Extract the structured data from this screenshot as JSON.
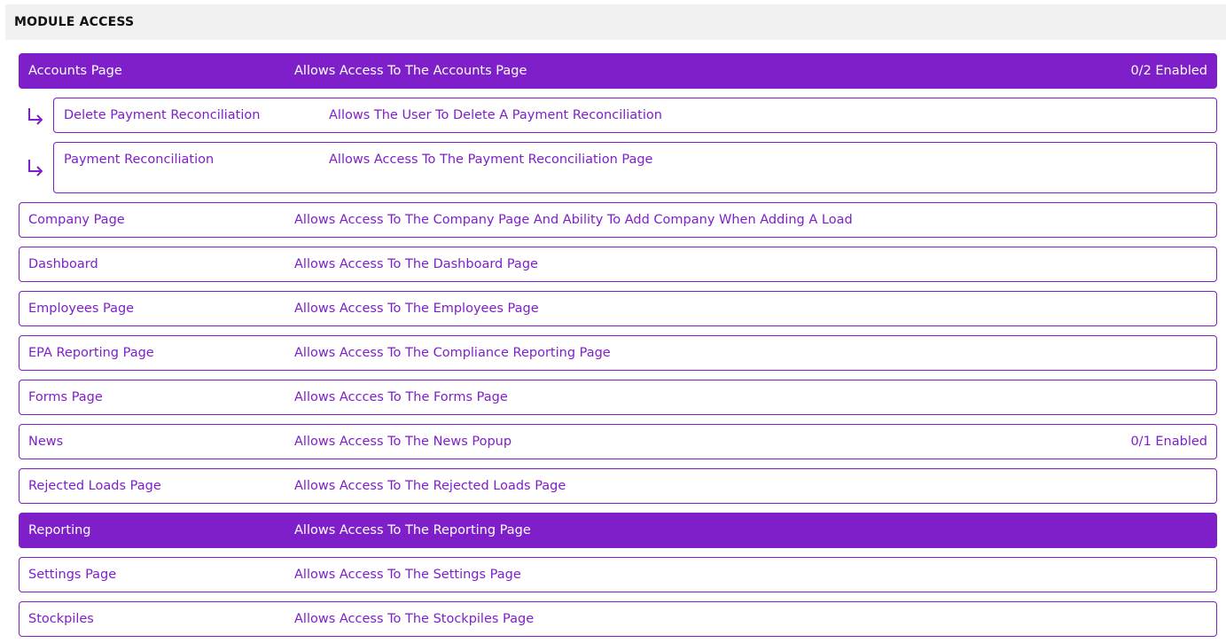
{
  "section": {
    "title": "MODULE ACCESS"
  },
  "modules": [
    {
      "name": "Accounts Page",
      "description": "Allows Access To The Accounts Page",
      "status": "0/2 Enabled"
    },
    {
      "name": "Delete Payment Reconciliation",
      "description": "Allows The User To Delete A Payment Reconciliation"
    },
    {
      "name": "Payment Reconciliation",
      "description": "Allows Access To The Payment Reconciliation Page"
    },
    {
      "name": "Company Page",
      "description": "Allows Access To The Company Page And Ability To Add Company When Adding A Load"
    },
    {
      "name": "Dashboard",
      "description": "Allows Access To The Dashboard Page"
    },
    {
      "name": "Employees Page",
      "description": "Allows Access To The Employees Page"
    },
    {
      "name": "EPA Reporting Page",
      "description": "Allows Access To The Compliance Reporting Page"
    },
    {
      "name": "Forms Page",
      "description": "Allows Accces To The Forms Page"
    },
    {
      "name": "News",
      "description": "Allows Access To The News Popup",
      "status": "0/1 Enabled"
    },
    {
      "name": "Rejected Loads Page",
      "description": "Allows Access To The Rejected Loads Page"
    },
    {
      "name": "Reporting",
      "description": "Allows Access To The Reporting Page"
    },
    {
      "name": "Settings Page",
      "description": "Allows Access To The Settings Page"
    },
    {
      "name": "Stockpiles",
      "description": "Allows Access To The Stockpiles Page"
    }
  ],
  "colors": {
    "accent": "#7e1fc9",
    "header_bg": "#f1f1f1",
    "active_text": "#ffffff"
  },
  "icons": {
    "sub_item": "arrow-down-right-icon"
  }
}
